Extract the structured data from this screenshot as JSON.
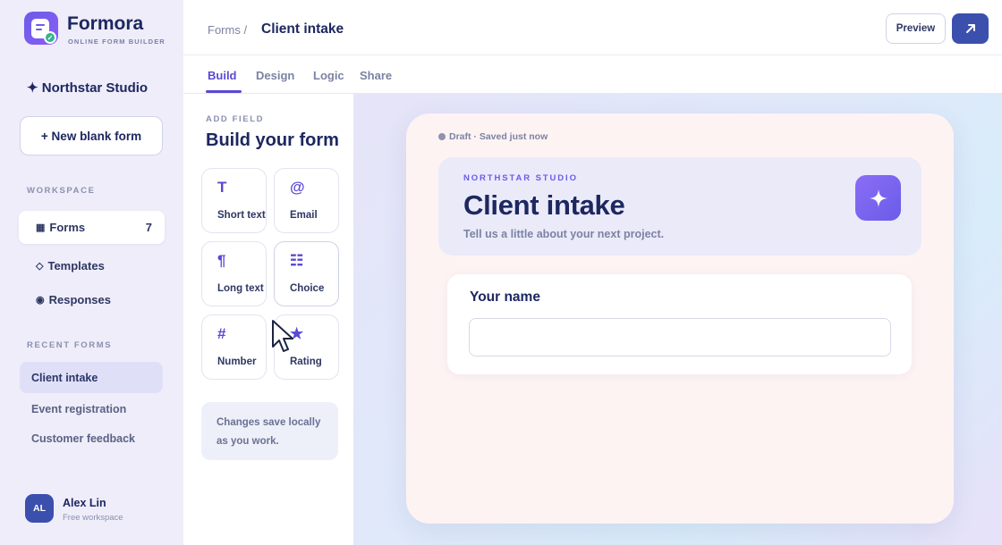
{
  "app": {
    "name": "Formora",
    "tagline": "ONLINE FORM BUILDER"
  },
  "sidebar": {
    "workspace_name": "✦ Northstar Studio",
    "new_form_label": "+ New blank form",
    "workspace_label": "WORKSPACE",
    "nav": [
      {
        "icon": "▦",
        "label": "Forms",
        "count": "7",
        "active": true
      },
      {
        "icon": "◇",
        "label": "Templates"
      },
      {
        "icon": "◉",
        "label": "Responses"
      }
    ],
    "recent_label": "RECENT FORMS",
    "recent": [
      {
        "label": "Client intake",
        "active": true
      },
      {
        "label": "Event registration"
      },
      {
        "label": "Customer feedback"
      }
    ],
    "user": {
      "initials": "AL",
      "name": "Alex Lin",
      "plan": "Free workspace"
    }
  },
  "header": {
    "breadcrumb": "Forms /",
    "title": "Client intake",
    "preview_label": "Preview",
    "share_icon": "arrow-up-right-icon"
  },
  "tabs": [
    {
      "label": "Build",
      "active": true
    },
    {
      "label": "Design"
    },
    {
      "label": "Logic"
    },
    {
      "label": "Share"
    }
  ],
  "fields_panel": {
    "eyebrow": "ADD FIELD",
    "title": "Build your form",
    "fields": [
      {
        "icon": "T",
        "label": "Short text"
      },
      {
        "icon": "@",
        "label": "Email"
      },
      {
        "icon": "¶",
        "label": "Long text"
      },
      {
        "icon": "☷",
        "label": "Choice"
      },
      {
        "icon": "#",
        "label": "Number"
      },
      {
        "icon": "★",
        "label": "Rating"
      }
    ],
    "note": "Changes save locally as you work."
  },
  "form": {
    "status": "Draft · Saved just now",
    "eyebrow": "NORTHSTAR STUDIO",
    "title": "Client intake",
    "subtitle": "Tell us a little about your next project.",
    "badge_icon": "sparkle-icon",
    "question": {
      "label": "Your name",
      "value": "",
      "placeholder": ""
    }
  },
  "colors": {
    "accent": "#5a48d6",
    "primary": "#3b4fad",
    "success": "#2fb58c"
  }
}
